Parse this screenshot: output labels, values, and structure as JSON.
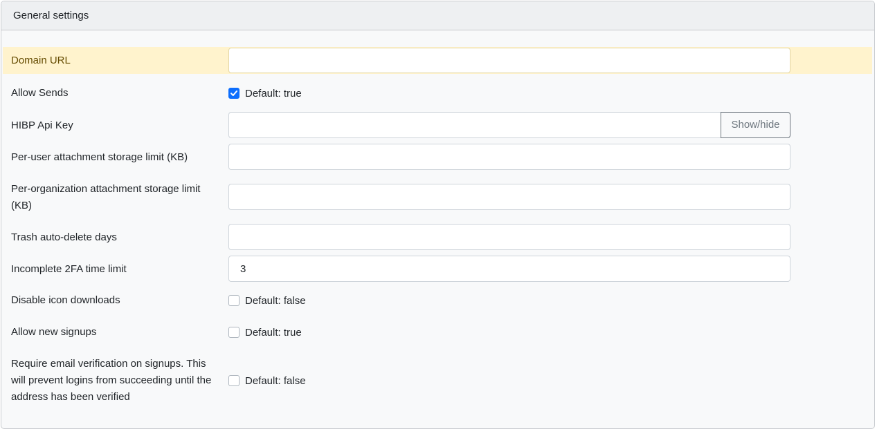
{
  "header": {
    "title": "General settings"
  },
  "settings": {
    "domain_url": {
      "label": "Domain URL",
      "value": ""
    },
    "allow_sends": {
      "label": "Allow Sends",
      "checked": true,
      "default_text": "Default: true"
    },
    "hibp_api_key": {
      "label": "HIBP Api Key",
      "value": "",
      "button_label": "Show/hide"
    },
    "user_attachment_limit": {
      "label": "Per-user attachment storage limit (KB)",
      "value": ""
    },
    "org_attachment_limit": {
      "label": "Per-organization attachment storage limit (KB)",
      "value": ""
    },
    "trash_auto_delete": {
      "label": "Trash auto-delete days",
      "value": ""
    },
    "incomplete_2fa": {
      "label": "Incomplete 2FA time limit",
      "value": "3"
    },
    "disable_icon_downloads": {
      "label": "Disable icon downloads",
      "checked": false,
      "default_text": "Default: false"
    },
    "allow_new_signups": {
      "label": "Allow new signups",
      "checked": false,
      "default_text": "Default: true"
    },
    "require_email_verification": {
      "label": "Require email verification on signups. This will prevent logins from succeeding until the address has been verified",
      "checked": false,
      "default_text": "Default: false"
    }
  },
  "colors": {
    "accent": "#0d6efd",
    "highlight_bg": "#fff3cd",
    "highlight_text": "#664d03"
  },
  "icons": {
    "check": "checkmark-icon"
  }
}
